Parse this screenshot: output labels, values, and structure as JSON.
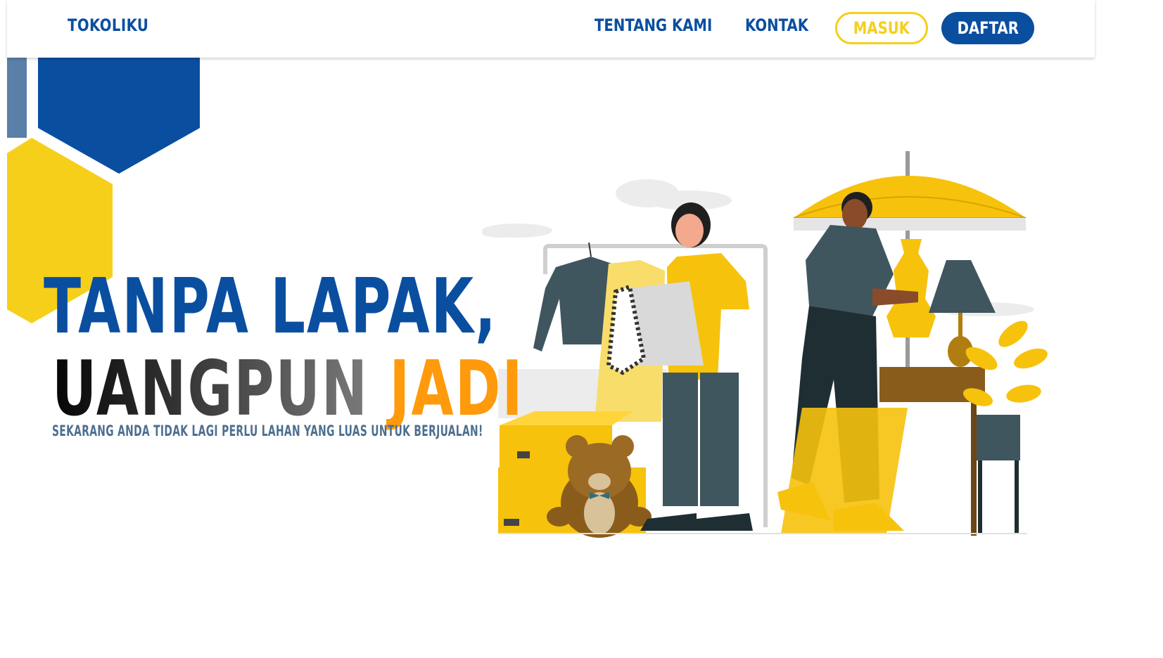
{
  "nav": {
    "brand": "TOKOLIKU",
    "links": [
      "TENTANG KAMI",
      "KONTAK"
    ],
    "login_label": "MASUK",
    "register_label": "DAFTAR"
  },
  "hero": {
    "line1": "TANPA LAPAK,",
    "line2_a": "UANGPUN",
    "line2_b": "JADI",
    "subtitle": "SEKARANG ANDA TIDAK LAGI PERLU LAHAN YANG LUAS UNTUK BERJUALAN!"
  },
  "colors": {
    "brand_blue": "#0a4ea0",
    "accent_yellow": "#f6cf1a",
    "accent_orange": "#ff9a0c",
    "muted_blue": "#4d6f8f"
  },
  "illustration": {
    "icon": "flea-market-seller-illustration"
  }
}
